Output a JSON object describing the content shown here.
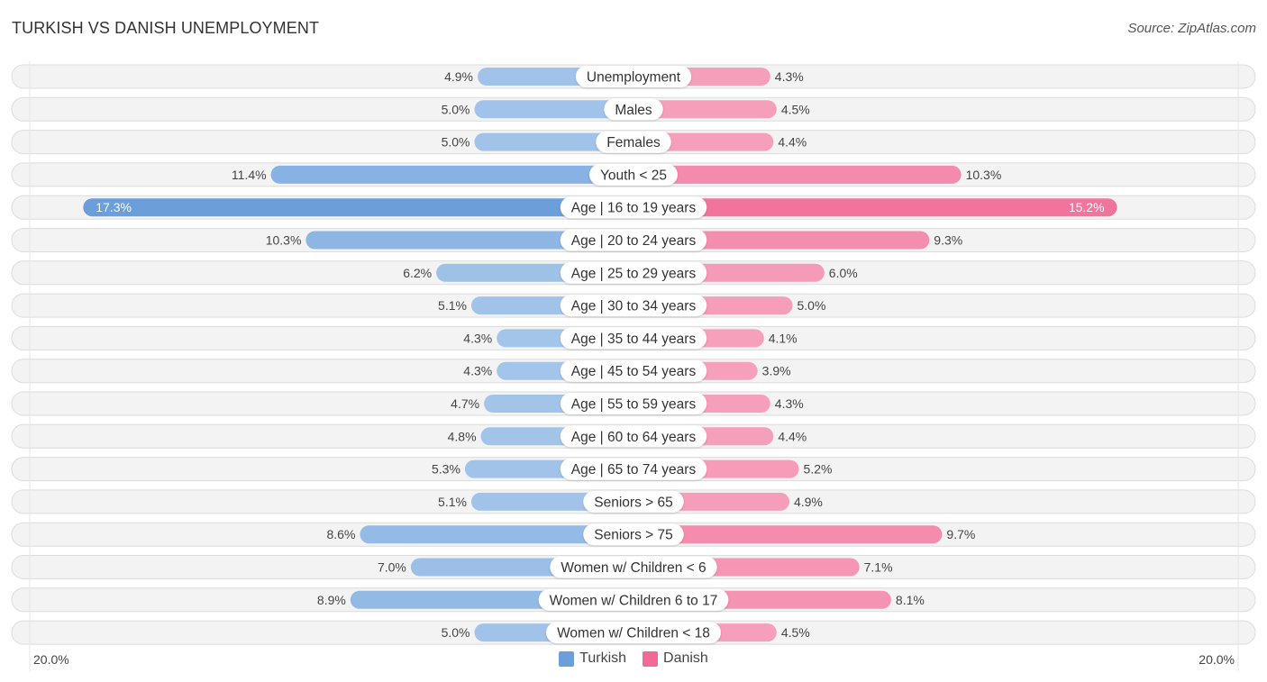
{
  "header": {
    "title": "TURKISH VS DANISH UNEMPLOYMENT",
    "source": "Source: ZipAtlas.com"
  },
  "axis": {
    "left_label": "20.0%",
    "right_label": "20.0%"
  },
  "legend": [
    {
      "name": "Turkish",
      "color": "#6a9fdb"
    },
    {
      "name": "Danish",
      "color": "#f06a95"
    }
  ],
  "chart_data": {
    "type": "bar",
    "orientation": "horizontal-diverging",
    "title": "TURKISH VS DANISH UNEMPLOYMENT",
    "xlim": [
      -20,
      20
    ],
    "unit": "%",
    "categories": [
      "Unemployment",
      "Males",
      "Females",
      "Youth < 25",
      "Age | 16 to 19 years",
      "Age | 20 to 24 years",
      "Age | 25 to 29 years",
      "Age | 30 to 34 years",
      "Age | 35 to 44 years",
      "Age | 45 to 54 years",
      "Age | 55 to 59 years",
      "Age | 60 to 64 years",
      "Age | 65 to 74 years",
      "Seniors > 65",
      "Seniors > 75",
      "Women w/ Children < 6",
      "Women w/ Children 6 to 17",
      "Women w/ Children < 18"
    ],
    "series": [
      {
        "name": "Turkish",
        "side": "left",
        "color": "#6a9fdb",
        "values": [
          4.9,
          5.0,
          5.0,
          11.4,
          17.3,
          10.3,
          6.2,
          5.1,
          4.3,
          4.3,
          4.7,
          4.8,
          5.3,
          5.1,
          8.6,
          7.0,
          8.9,
          5.0
        ],
        "labels": [
          "4.9%",
          "5.0%",
          "5.0%",
          "11.4%",
          "17.3%",
          "10.3%",
          "6.2%",
          "5.1%",
          "4.3%",
          "4.3%",
          "4.7%",
          "4.8%",
          "5.3%",
          "5.1%",
          "8.6%",
          "7.0%",
          "8.9%",
          "5.0%"
        ]
      },
      {
        "name": "Danish",
        "side": "right",
        "color": "#f06a95",
        "values": [
          4.3,
          4.5,
          4.4,
          10.3,
          15.2,
          9.3,
          6.0,
          5.0,
          4.1,
          3.9,
          4.3,
          4.4,
          5.2,
          4.9,
          9.7,
          7.1,
          8.1,
          4.5
        ],
        "labels": [
          "4.3%",
          "4.5%",
          "4.4%",
          "10.3%",
          "15.2%",
          "9.3%",
          "6.0%",
          "5.0%",
          "4.1%",
          "3.9%",
          "4.3%",
          "4.4%",
          "5.2%",
          "4.9%",
          "9.7%",
          "7.1%",
          "8.1%",
          "4.5%"
        ]
      }
    ],
    "axis_tick_labels": [
      "20.0%",
      "20.0%"
    ],
    "legend_position": "bottom-center",
    "grid": false
  }
}
